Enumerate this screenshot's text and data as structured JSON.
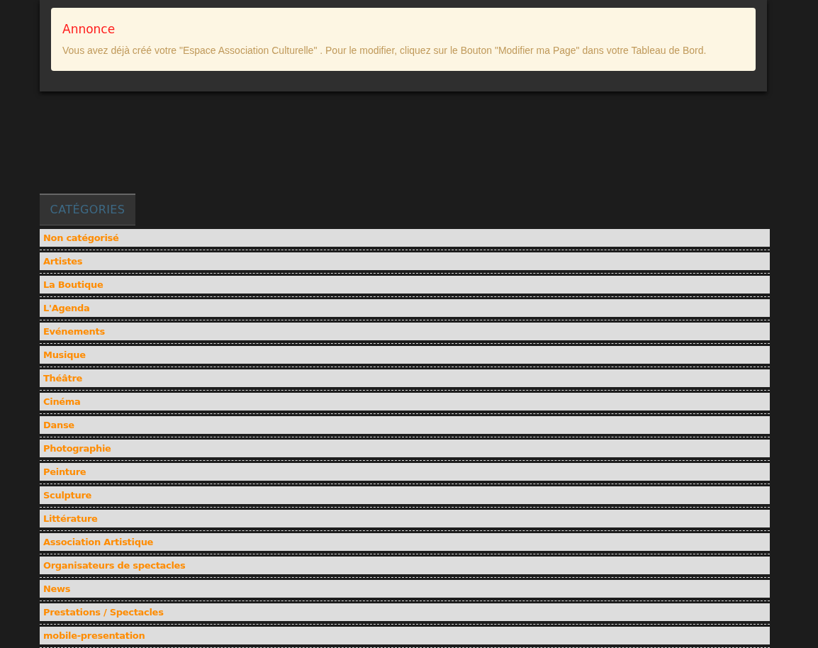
{
  "notice": {
    "title": "Annonce",
    "message": "Vous avez déjà créé votre \"Espace Association Culturelle\" . Pour le modifier, cliquez sur le Bouton \"Modifier ma Page\" dans votre Tableau de Bord."
  },
  "categories": {
    "title": "CATÉGORIES",
    "items": [
      "Non catégorisé",
      "Artistes",
      "La Boutique",
      "L'Agenda",
      "Evénements",
      "Musique",
      "Théâtre",
      "Cinéma",
      "Danse",
      "Photographie",
      "Peinture",
      "Sculpture",
      "Littérature",
      "Association Artistique",
      "Organisateurs de spectacles",
      "News",
      "Prestations / Spectacles",
      "mobile-presentation"
    ]
  }
}
